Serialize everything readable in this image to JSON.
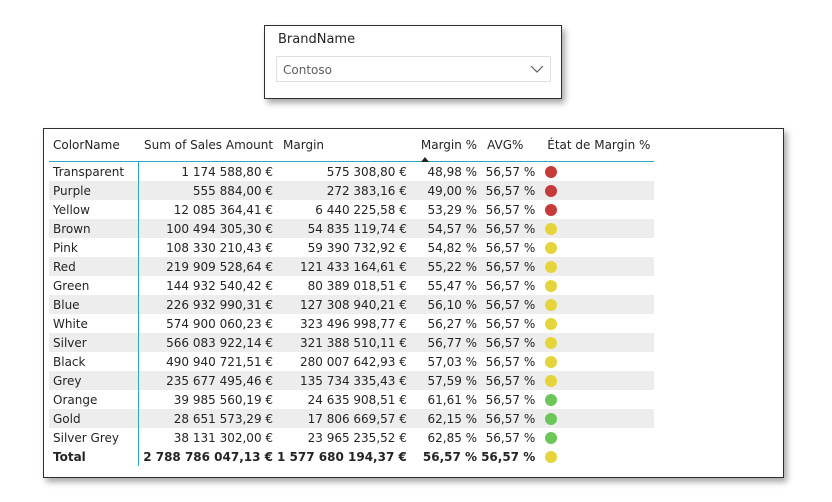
{
  "slicer": {
    "title": "BrandName",
    "selected_value": "Contoso"
  },
  "table": {
    "headers": {
      "color": "ColorName",
      "sales": "Sum of Sales Amount",
      "margin": "Margin",
      "margin_pct": "Margin %",
      "avg": "AVG%",
      "status": "État de Margin %"
    },
    "sorted_column": "Margin %",
    "rows": [
      {
        "color": "Transparent",
        "sales": "1 174 588,80 €",
        "margin": "575 308,80 €",
        "margin_pct": "48,98 %",
        "avg": "56,57 %",
        "status_color": "#c73a3a"
      },
      {
        "color": "Purple",
        "sales": "555 884,00 €",
        "margin": "272 383,16 €",
        "margin_pct": "49,00 %",
        "avg": "56,57 %",
        "status_color": "#c73a3a"
      },
      {
        "color": "Yellow",
        "sales": "12 085 364,41 €",
        "margin": "6 440 225,58 €",
        "margin_pct": "53,29 %",
        "avg": "56,57 %",
        "status_color": "#c73a3a"
      },
      {
        "color": "Brown",
        "sales": "100 494 305,30 €",
        "margin": "54 835 119,74 €",
        "margin_pct": "54,57 %",
        "avg": "56,57 %",
        "status_color": "#e6d43c"
      },
      {
        "color": "Pink",
        "sales": "108 330 210,43 €",
        "margin": "59 390 732,92 €",
        "margin_pct": "54,82 %",
        "avg": "56,57 %",
        "status_color": "#e6d43c"
      },
      {
        "color": "Red",
        "sales": "219 909 528,64 €",
        "margin": "121 433 164,61 €",
        "margin_pct": "55,22 %",
        "avg": "56,57 %",
        "status_color": "#e6d43c"
      },
      {
        "color": "Green",
        "sales": "144 932 540,42 €",
        "margin": "80 389 018,51 €",
        "margin_pct": "55,47 %",
        "avg": "56,57 %",
        "status_color": "#e6d43c"
      },
      {
        "color": "Blue",
        "sales": "226 932 990,31 €",
        "margin": "127 308 940,21 €",
        "margin_pct": "56,10 %",
        "avg": "56,57 %",
        "status_color": "#e6d43c"
      },
      {
        "color": "White",
        "sales": "574 900 060,23 €",
        "margin": "323 496 998,77 €",
        "margin_pct": "56,27 %",
        "avg": "56,57 %",
        "status_color": "#e6d43c"
      },
      {
        "color": "Silver",
        "sales": "566 083 922,14 €",
        "margin": "321 388 510,11 €",
        "margin_pct": "56,77 %",
        "avg": "56,57 %",
        "status_color": "#e6d43c"
      },
      {
        "color": "Black",
        "sales": "490 940 721,51 €",
        "margin": "280 007 642,93 €",
        "margin_pct": "57,03 %",
        "avg": "56,57 %",
        "status_color": "#e6d43c"
      },
      {
        "color": "Grey",
        "sales": "235 677 495,46 €",
        "margin": "135 734 335,43 €",
        "margin_pct": "57,59 %",
        "avg": "56,57 %",
        "status_color": "#e6d43c"
      },
      {
        "color": "Orange",
        "sales": "39 985 560,19 €",
        "margin": "24 635 908,51 €",
        "margin_pct": "61,61 %",
        "avg": "56,57 %",
        "status_color": "#6cc65a"
      },
      {
        "color": "Gold",
        "sales": "28 651 573,29 €",
        "margin": "17 806 669,57 €",
        "margin_pct": "62,15 %",
        "avg": "56,57 %",
        "status_color": "#6cc65a"
      },
      {
        "color": "Silver Grey",
        "sales": "38 131 302,00 €",
        "margin": "23 965 235,52 €",
        "margin_pct": "62,85 %",
        "avg": "56,57 %",
        "status_color": "#6cc65a"
      }
    ],
    "total": {
      "color": "Total",
      "sales": "2 788 786 047,13 €",
      "margin": "1 577 680 194,37 €",
      "margin_pct": "56,57 %",
      "avg": "56,57 %",
      "status_color": "#e6d43c"
    }
  },
  "colors": {
    "accent_line": "#2aa7c2",
    "red": "#c73a3a",
    "yellow": "#e6d43c",
    "green": "#6cc65a"
  },
  "icons": {
    "dropdown": "chevron-down-icon",
    "sort": "sort-ascending-icon"
  }
}
